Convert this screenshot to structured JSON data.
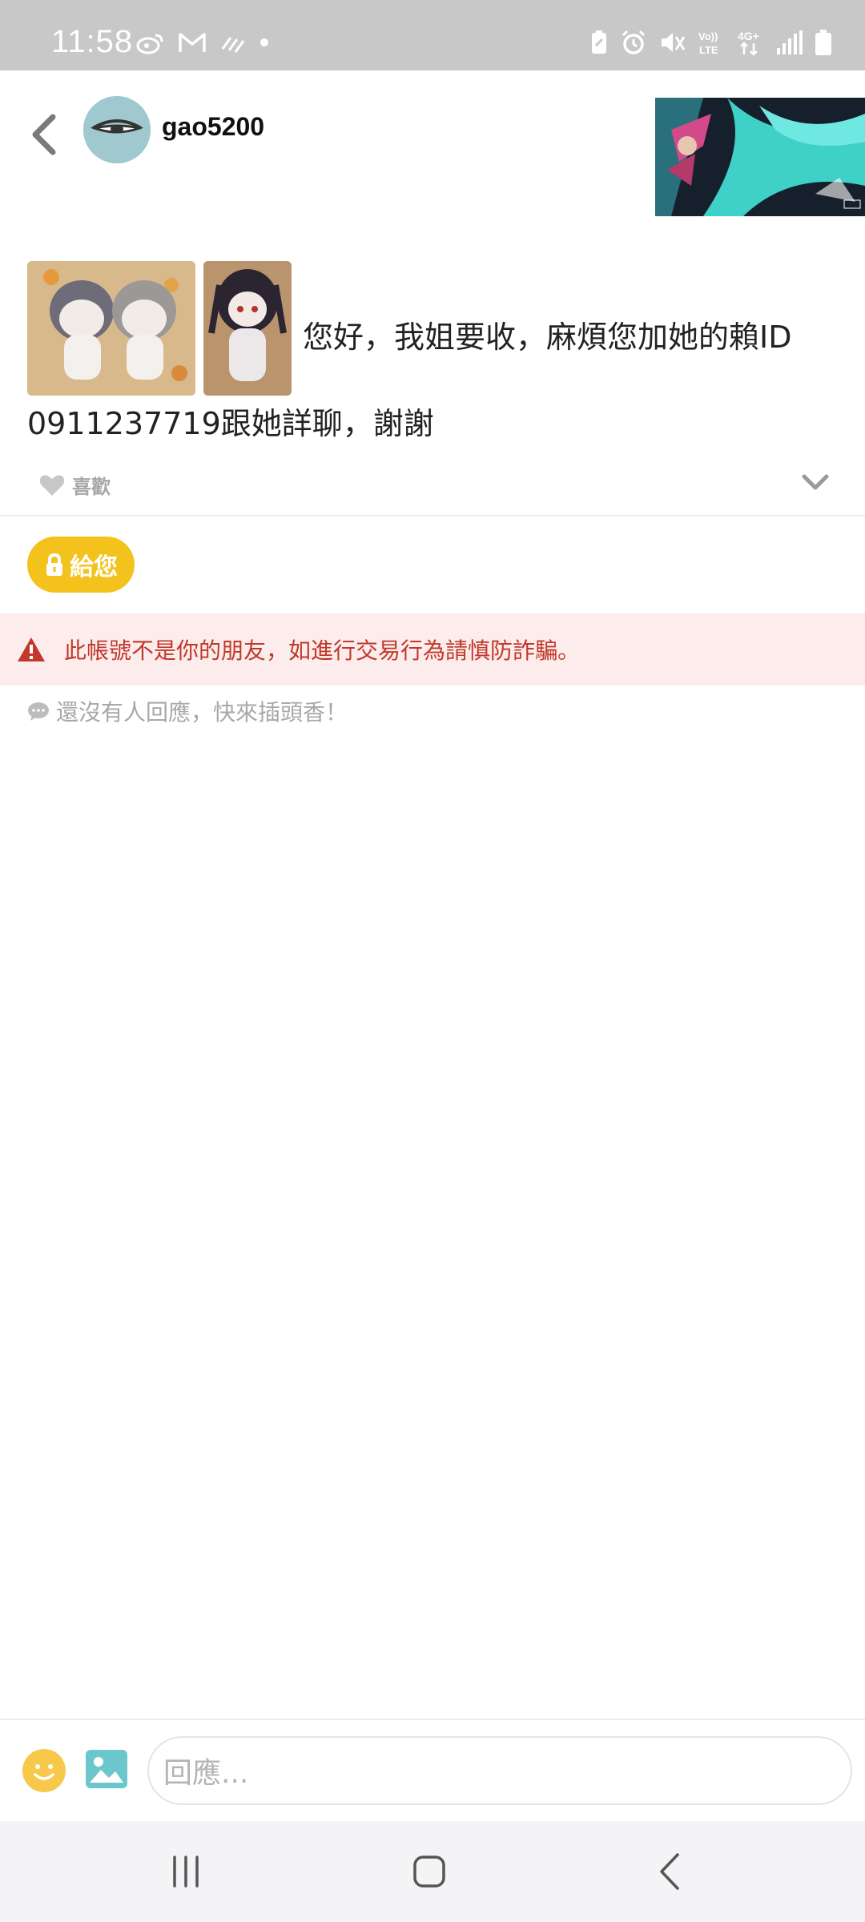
{
  "status_bar": {
    "time": "11:58",
    "left_icons": [
      "weibo-icon",
      "gmail-icon",
      "transfer-icon",
      "dot-icon"
    ],
    "right_icons": [
      "battery-saver-icon",
      "alarm-icon",
      "mute-icon",
      "volte-icon",
      "4g-icon",
      "signal-icon",
      "battery-icon"
    ],
    "volte_label": "Vo)) LTE",
    "network_label": "4G+"
  },
  "header": {
    "back_icon": "chevron-left-icon",
    "username": "gao5200"
  },
  "post": {
    "text_line1": "您好，我姐要收，麻煩您加她的賴ID",
    "text_line2": "0911237719跟她詳聊，謝謝",
    "like_label": "喜歡",
    "expand_icon": "chevron-down-icon"
  },
  "tip_button": {
    "label": "給您",
    "icon": "lock-icon"
  },
  "warning": {
    "text": "此帳號不是你的朋友，如進行交易行為請慎防詐騙。",
    "icon": "warning-triangle-icon"
  },
  "comments": {
    "empty_text": "還沒有人回應，快來插頭香！",
    "icon": "chat-bubble-icon"
  },
  "reply_bar": {
    "placeholder": "回應..."
  },
  "nav_bar": {
    "items": [
      "recent-apps-icon",
      "home-icon",
      "back-icon"
    ]
  },
  "colors": {
    "accent_yellow": "#f4c21c",
    "warning_red": "#c0392b",
    "warning_bg": "#fdecec",
    "status_bar_bg": "#c8c8c8"
  }
}
